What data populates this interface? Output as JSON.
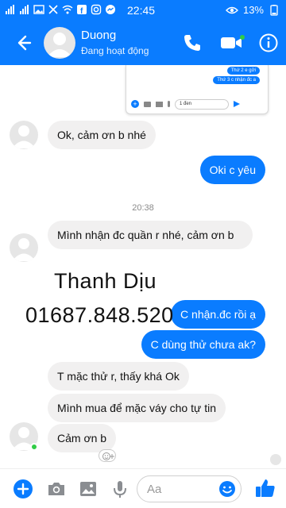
{
  "status_bar": {
    "time": "22:45",
    "battery": "13%"
  },
  "header": {
    "contact_name": "Duong",
    "contact_status": "Đang hoạt động"
  },
  "shared_screenshot": {
    "messages": [
      "Thứ 2 e gửi",
      "Thứ 3 c nhận đc a"
    ],
    "input_value": "1 đen"
  },
  "messages": [
    {
      "text": "Ok, cảm ơn b nhé"
    },
    {
      "text": "Oki c yêu"
    },
    {
      "text": "Mình nhận đc quần r nhé, cảm ơn b"
    },
    {
      "text": "C nhận.đc rồi ạ"
    },
    {
      "text": "C dùng thử chưa ak?"
    },
    {
      "text": "T mặc thử r, thấy khá Ok"
    },
    {
      "text": "Mình mua để mặc váy cho tự tin"
    },
    {
      "text": "Cảm ơn b"
    }
  ],
  "time_separator": "20:38",
  "watermark": {
    "name": "Thanh Dịu",
    "phone": "01687.848.520"
  },
  "composer": {
    "placeholder": "Aa"
  },
  "colors": {
    "accent": "#0a7cff",
    "incoming_bubble": "#f1f0f0",
    "online": "#31cc46"
  }
}
